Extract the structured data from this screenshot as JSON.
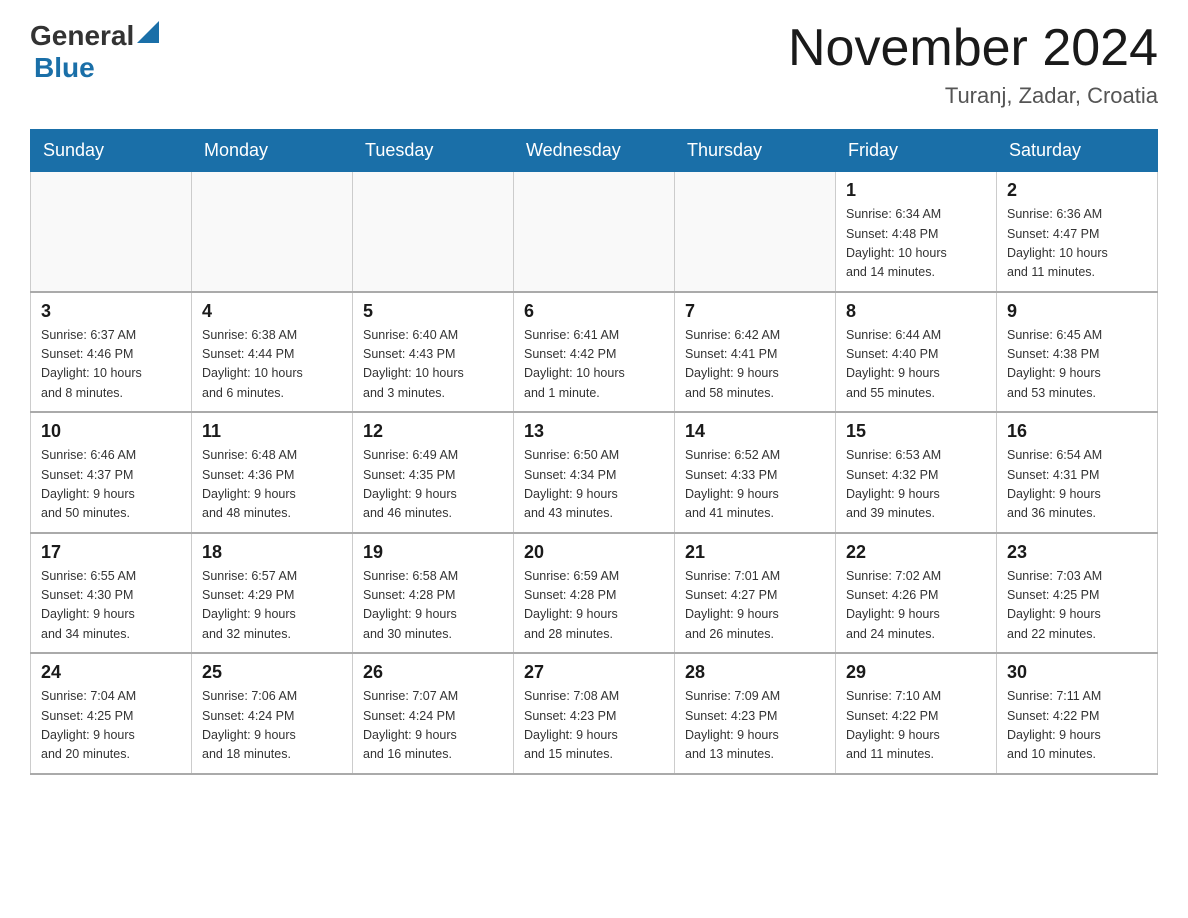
{
  "header": {
    "logo_general": "General",
    "logo_blue": "Blue",
    "title": "November 2024",
    "subtitle": "Turanj, Zadar, Croatia"
  },
  "days_of_week": [
    "Sunday",
    "Monday",
    "Tuesday",
    "Wednesday",
    "Thursday",
    "Friday",
    "Saturday"
  ],
  "weeks": [
    [
      {
        "day": "",
        "info": ""
      },
      {
        "day": "",
        "info": ""
      },
      {
        "day": "",
        "info": ""
      },
      {
        "day": "",
        "info": ""
      },
      {
        "day": "",
        "info": ""
      },
      {
        "day": "1",
        "info": "Sunrise: 6:34 AM\nSunset: 4:48 PM\nDaylight: 10 hours\nand 14 minutes."
      },
      {
        "day": "2",
        "info": "Sunrise: 6:36 AM\nSunset: 4:47 PM\nDaylight: 10 hours\nand 11 minutes."
      }
    ],
    [
      {
        "day": "3",
        "info": "Sunrise: 6:37 AM\nSunset: 4:46 PM\nDaylight: 10 hours\nand 8 minutes."
      },
      {
        "day": "4",
        "info": "Sunrise: 6:38 AM\nSunset: 4:44 PM\nDaylight: 10 hours\nand 6 minutes."
      },
      {
        "day": "5",
        "info": "Sunrise: 6:40 AM\nSunset: 4:43 PM\nDaylight: 10 hours\nand 3 minutes."
      },
      {
        "day": "6",
        "info": "Sunrise: 6:41 AM\nSunset: 4:42 PM\nDaylight: 10 hours\nand 1 minute."
      },
      {
        "day": "7",
        "info": "Sunrise: 6:42 AM\nSunset: 4:41 PM\nDaylight: 9 hours\nand 58 minutes."
      },
      {
        "day": "8",
        "info": "Sunrise: 6:44 AM\nSunset: 4:40 PM\nDaylight: 9 hours\nand 55 minutes."
      },
      {
        "day": "9",
        "info": "Sunrise: 6:45 AM\nSunset: 4:38 PM\nDaylight: 9 hours\nand 53 minutes."
      }
    ],
    [
      {
        "day": "10",
        "info": "Sunrise: 6:46 AM\nSunset: 4:37 PM\nDaylight: 9 hours\nand 50 minutes."
      },
      {
        "day": "11",
        "info": "Sunrise: 6:48 AM\nSunset: 4:36 PM\nDaylight: 9 hours\nand 48 minutes."
      },
      {
        "day": "12",
        "info": "Sunrise: 6:49 AM\nSunset: 4:35 PM\nDaylight: 9 hours\nand 46 minutes."
      },
      {
        "day": "13",
        "info": "Sunrise: 6:50 AM\nSunset: 4:34 PM\nDaylight: 9 hours\nand 43 minutes."
      },
      {
        "day": "14",
        "info": "Sunrise: 6:52 AM\nSunset: 4:33 PM\nDaylight: 9 hours\nand 41 minutes."
      },
      {
        "day": "15",
        "info": "Sunrise: 6:53 AM\nSunset: 4:32 PM\nDaylight: 9 hours\nand 39 minutes."
      },
      {
        "day": "16",
        "info": "Sunrise: 6:54 AM\nSunset: 4:31 PM\nDaylight: 9 hours\nand 36 minutes."
      }
    ],
    [
      {
        "day": "17",
        "info": "Sunrise: 6:55 AM\nSunset: 4:30 PM\nDaylight: 9 hours\nand 34 minutes."
      },
      {
        "day": "18",
        "info": "Sunrise: 6:57 AM\nSunset: 4:29 PM\nDaylight: 9 hours\nand 32 minutes."
      },
      {
        "day": "19",
        "info": "Sunrise: 6:58 AM\nSunset: 4:28 PM\nDaylight: 9 hours\nand 30 minutes."
      },
      {
        "day": "20",
        "info": "Sunrise: 6:59 AM\nSunset: 4:28 PM\nDaylight: 9 hours\nand 28 minutes."
      },
      {
        "day": "21",
        "info": "Sunrise: 7:01 AM\nSunset: 4:27 PM\nDaylight: 9 hours\nand 26 minutes."
      },
      {
        "day": "22",
        "info": "Sunrise: 7:02 AM\nSunset: 4:26 PM\nDaylight: 9 hours\nand 24 minutes."
      },
      {
        "day": "23",
        "info": "Sunrise: 7:03 AM\nSunset: 4:25 PM\nDaylight: 9 hours\nand 22 minutes."
      }
    ],
    [
      {
        "day": "24",
        "info": "Sunrise: 7:04 AM\nSunset: 4:25 PM\nDaylight: 9 hours\nand 20 minutes."
      },
      {
        "day": "25",
        "info": "Sunrise: 7:06 AM\nSunset: 4:24 PM\nDaylight: 9 hours\nand 18 minutes."
      },
      {
        "day": "26",
        "info": "Sunrise: 7:07 AM\nSunset: 4:24 PM\nDaylight: 9 hours\nand 16 minutes."
      },
      {
        "day": "27",
        "info": "Sunrise: 7:08 AM\nSunset: 4:23 PM\nDaylight: 9 hours\nand 15 minutes."
      },
      {
        "day": "28",
        "info": "Sunrise: 7:09 AM\nSunset: 4:23 PM\nDaylight: 9 hours\nand 13 minutes."
      },
      {
        "day": "29",
        "info": "Sunrise: 7:10 AM\nSunset: 4:22 PM\nDaylight: 9 hours\nand 11 minutes."
      },
      {
        "day": "30",
        "info": "Sunrise: 7:11 AM\nSunset: 4:22 PM\nDaylight: 9 hours\nand 10 minutes."
      }
    ]
  ]
}
